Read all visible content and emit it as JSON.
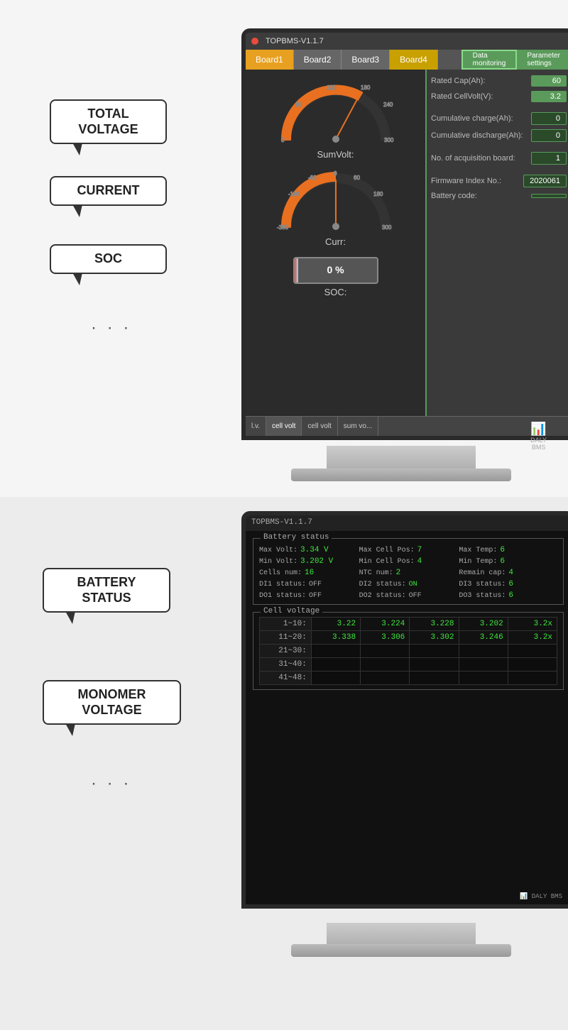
{
  "section1": {
    "bubbles": {
      "total_voltage": "TOTAL\nVOLTAGE",
      "current": "CURRENT",
      "soc": "SOC",
      "dots": "· · ·"
    },
    "monitor": {
      "title": "TOPBMS-V1.1.7",
      "tabs": [
        "Board1",
        "Board2",
        "Board3",
        "Board4"
      ],
      "sub_tabs": [
        "Data\nmonitoring",
        "Parameter\nsettings"
      ],
      "gauges": {
        "sum_volt_label": "SumVolt:",
        "curr_label": "Curr:",
        "soc_label": "SOC:"
      },
      "right_panel": {
        "rated_cap_label": "Rated Cap(Ah):",
        "rated_cap_value": "60",
        "rated_cell_volt_label": "Rated CellVolt(V):",
        "rated_cell_volt_value": "3.2",
        "cumulative_charge_label": "Cumulative charge(Ah):",
        "cumulative_charge_value": "0",
        "cumulative_discharge_label": "Cumulative discharge(Ah):",
        "cumulative_discharge_value": "0",
        "acq_board_label": "No. of acquisition board:",
        "acq_board_value": "1",
        "firmware_label": "Firmware Index No.:",
        "firmware_value": "2020061",
        "battery_code_label": "Battery code:"
      },
      "bottom_tabs": [
        "l.v.",
        "cell volt",
        "cell volt",
        "sum vo..."
      ],
      "soc_percent": "0 %"
    }
  },
  "section2": {
    "bubbles": {
      "battery_status": "BATTERY\nSTATUS",
      "monomer_voltage": "MONOMER\nVOLTAGE",
      "dots": "· · ·"
    },
    "monitor": {
      "title": "TOPBMS-V1.1.7",
      "battery_status": {
        "section_title": "Battery status",
        "max_volt_label": "Max Volt:",
        "max_volt_value": "3.34 V",
        "max_cell_pos_label": "Max Cell Pos:",
        "max_cell_pos_value": "7",
        "max_temp_label": "Max Temp:",
        "max_temp_value": "6",
        "min_volt_label": "Min Volt:",
        "min_volt_value": "3.202 V",
        "min_cell_pos_label": "Min Cell Pos:",
        "min_cell_pos_value": "4",
        "min_temp_label": "Min Temp:",
        "min_temp_value": "6",
        "cells_num_label": "Cells num:",
        "cells_num_value": "16",
        "ntc_num_label": "NTC num:",
        "ntc_num_value": "2",
        "remain_cap_label": "Remain cap:",
        "remain_cap_value": "4",
        "di1_label": "DI1 status:",
        "di1_value": "OFF",
        "di2_label": "DI2 status:",
        "di2_value": "ON",
        "di3_label": "DI3 status:",
        "di3_value": "6",
        "do1_label": "DO1 status:",
        "do1_value": "OFF",
        "do2_label": "DO2 status:",
        "do2_value": "OFF",
        "do3_label": "DO3 status:",
        "do3_value": "6"
      },
      "cell_voltage": {
        "section_title": "Cell voltage",
        "rows": [
          {
            "label": "1~10:",
            "values": [
              "3.22",
              "3.224",
              "3.228",
              "3.202",
              "3.2x"
            ]
          },
          {
            "label": "11~20:",
            "values": [
              "3.338",
              "3.306",
              "3.302",
              "3.246",
              "3.2x"
            ]
          },
          {
            "label": "21~30:",
            "values": [
              "",
              "",
              "",
              "",
              ""
            ]
          },
          {
            "label": "31~40:",
            "values": [
              "",
              "",
              "",
              "",
              ""
            ]
          },
          {
            "label": "41~48:",
            "values": [
              "",
              "",
              "",
              "",
              ""
            ]
          }
        ]
      }
    }
  }
}
